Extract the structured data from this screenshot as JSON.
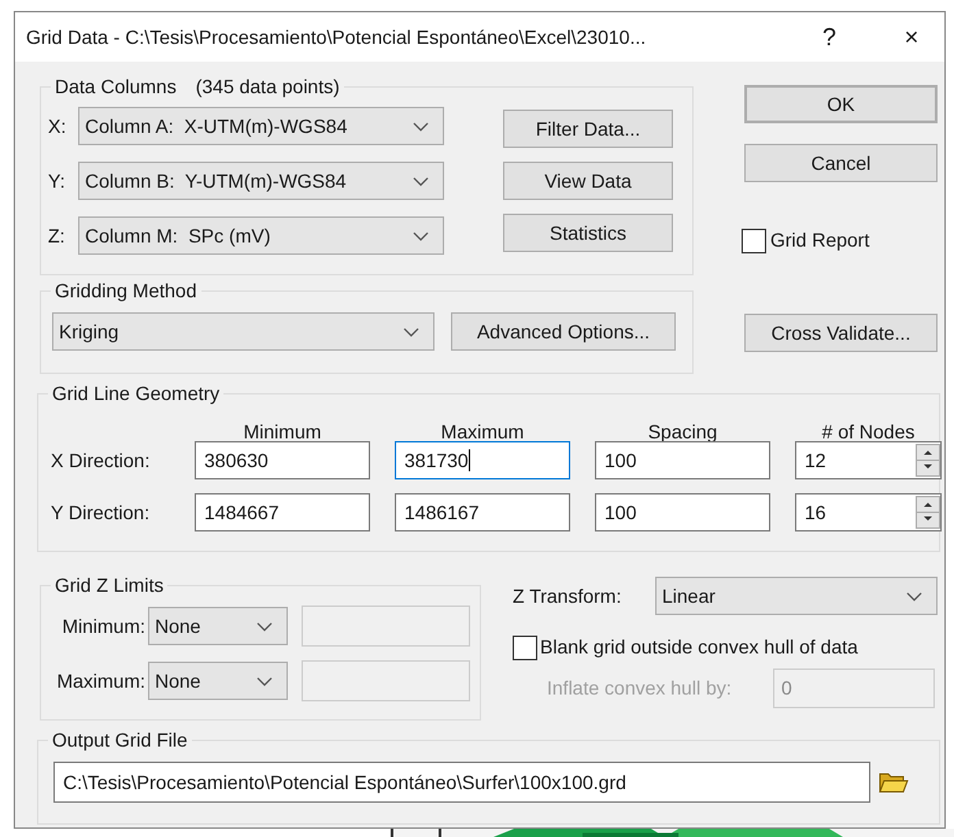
{
  "window": {
    "title": "Grid Data - C:\\Tesis\\Procesamiento\\Potencial Espontáneo\\Excel\\23010...",
    "title_buttons": [
      "?",
      "×"
    ]
  },
  "data_columns": {
    "title": "Data Columns",
    "count": "(345 data points)",
    "rows": [
      {
        "label": "X:",
        "value": "Column A:  X-UTM(m)-WGS84"
      },
      {
        "label": "Y:",
        "value": "Column B:  Y-UTM(m)-WGS84"
      },
      {
        "label": "Z:",
        "value": "Column M:  SPc (mV)"
      }
    ],
    "buttons": [
      "Filter Data...",
      "View Data",
      "Statistics"
    ]
  },
  "dialog_buttons": [
    {
      "label": "OK",
      "default": true
    },
    {
      "label": "Cancel",
      "default": false
    }
  ],
  "grid_report": {
    "label": "Grid Report",
    "checked": false
  },
  "gridding_method": {
    "title": "Gridding Method",
    "value": "Kriging",
    "button": "Advanced Options..."
  },
  "cross_validate": "Cross Validate...",
  "grid_line_geometry": {
    "title": "Grid Line Geometry",
    "columns": [
      "Minimum",
      "Maximum",
      "Spacing",
      "# of Nodes"
    ],
    "rows": [
      {
        "label": "X Direction:",
        "cells": [
          {
            "value": "380630",
            "focused": false
          },
          {
            "value": "381730",
            "focused": true
          },
          {
            "value": "100",
            "focused": false
          },
          {
            "value": "12",
            "focused": false
          }
        ]
      },
      {
        "label": "Y Direction:",
        "cells": [
          {
            "value": "1484667",
            "focused": false
          },
          {
            "value": "1486167",
            "focused": false
          },
          {
            "value": "100",
            "focused": false
          },
          {
            "value": "16",
            "focused": false
          }
        ]
      }
    ]
  },
  "grid_z_limits": {
    "title": "Grid Z Limits",
    "rows": [
      {
        "label": "Minimum:",
        "value": "None"
      },
      {
        "label": "Maximum:",
        "value": "None"
      }
    ]
  },
  "z_transform": {
    "label": "Z Transform:",
    "value": "Linear"
  },
  "blank_hull": {
    "label": "Blank grid outside convex hull of data",
    "checked": false
  },
  "inflate_hull": {
    "label": "Inflate convex hull by:",
    "value": "0",
    "disabled": true
  },
  "output_grid_file": {
    "title": "Output Grid File",
    "path": "C:\\Tesis\\Procesamiento\\Potencial Espontáneo\\Surfer\\100x100.grd"
  }
}
